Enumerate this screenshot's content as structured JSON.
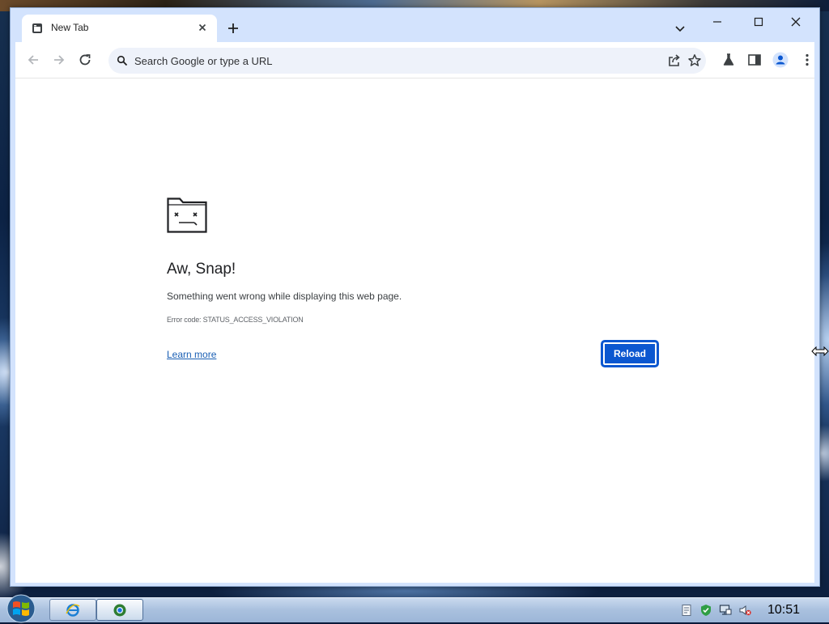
{
  "browser": {
    "tab": {
      "title": "New Tab"
    },
    "omnibox": {
      "placeholder": "Search Google or type a URL",
      "value": ""
    }
  },
  "error_page": {
    "title": "Aw, Snap!",
    "message": "Something went wrong while displaying this web page.",
    "error_code": "Error code: STATUS_ACCESS_VIOLATION",
    "learn_more": "Learn more",
    "reload_button": "Reload"
  },
  "taskbar": {
    "clock": "10:51"
  },
  "colors": {
    "accent": "#0b57d0",
    "frame": "#d3e3fd",
    "link": "#1a5fb4"
  }
}
